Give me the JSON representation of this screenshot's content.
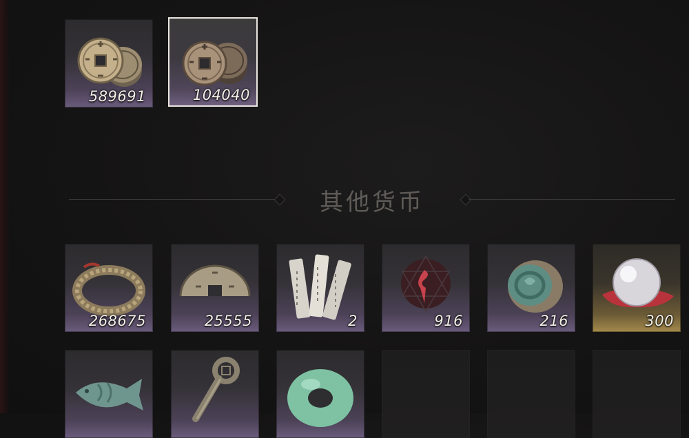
{
  "screen": {
    "section_title": "其他货币"
  },
  "currency_top": [
    {
      "name": "copper-coin-stack",
      "count": "589691",
      "selected": false
    },
    {
      "name": "bronze-coin-stack",
      "count": "104040",
      "selected": true
    }
  ],
  "currency_other": [
    {
      "name": "coin-string",
      "count": "268675"
    },
    {
      "name": "half-coin",
      "count": "25555"
    },
    {
      "name": "paper-slips",
      "count": "2"
    },
    {
      "name": "red-token",
      "count": "916"
    },
    {
      "name": "jade-relic",
      "count": "216"
    },
    {
      "name": "pearl",
      "count": "300"
    },
    {
      "name": "jade-fish",
      "count": ""
    },
    {
      "name": "coin-sword",
      "count": ""
    },
    {
      "name": "jade-ring",
      "count": ""
    }
  ],
  "colors": {
    "background": "#151414",
    "slot_bottom_purple": "#6a5b7c",
    "slot_bottom_gold": "#a48a4a",
    "selected_border": "#e9e6e0",
    "count_text": "#f2efe8",
    "header_text": "#5f5c58"
  }
}
